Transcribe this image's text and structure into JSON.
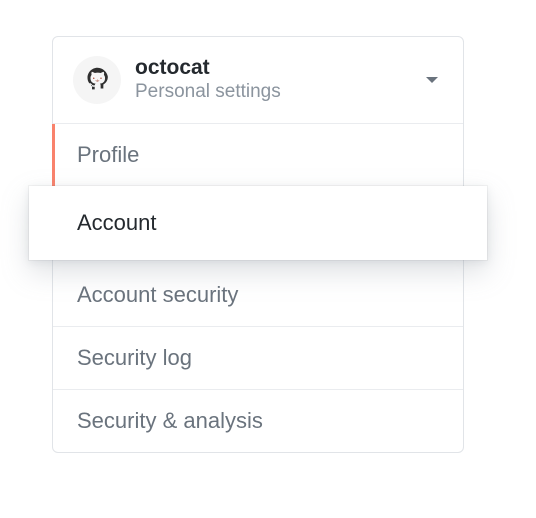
{
  "header": {
    "username": "octocat",
    "subtitle": "Personal settings"
  },
  "nav": {
    "items": [
      {
        "label": "Profile"
      },
      {
        "label": "Account"
      },
      {
        "label": "Account security"
      },
      {
        "label": "Security log"
      },
      {
        "label": "Security & analysis"
      }
    ]
  }
}
